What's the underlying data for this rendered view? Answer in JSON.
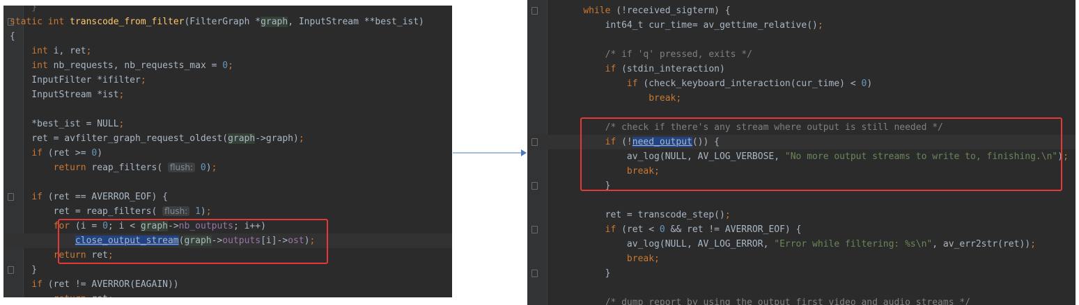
{
  "left": {
    "lines": [
      [
        {
          "t": "    }",
          "c": "fade"
        }
      ],
      [
        {
          "t": "static",
          "c": "kw"
        },
        {
          "t": " "
        },
        {
          "t": "int",
          "c": "kw"
        },
        {
          "t": " "
        },
        {
          "t": "transcode_from_filter",
          "c": "fn"
        },
        {
          "t": "(FilterGraph *"
        },
        {
          "t": "graph",
          "c": "param"
        },
        {
          "t": ", InputStream **best_ist)"
        }
      ],
      [
        {
          "t": "{"
        }
      ],
      [
        {
          "t": "    "
        },
        {
          "t": "int",
          "c": "kw"
        },
        {
          "t": " i, ret"
        },
        {
          "t": ";",
          "c": "kw"
        }
      ],
      [
        {
          "t": "    "
        },
        {
          "t": "int",
          "c": "kw"
        },
        {
          "t": " nb_requests, nb_requests_max = "
        },
        {
          "t": "0",
          "c": "num"
        },
        {
          "t": ";",
          "c": "kw"
        }
      ],
      [
        {
          "t": "    InputFilter *ifilter"
        },
        {
          "t": ";",
          "c": "kw"
        }
      ],
      [
        {
          "t": "    InputStream *ist"
        },
        {
          "t": ";",
          "c": "kw"
        }
      ],
      [
        {
          "t": ""
        }
      ],
      [
        {
          "t": "    *best_ist = NULL"
        },
        {
          "t": ";",
          "c": "kw"
        }
      ],
      [
        {
          "t": "    ret = avfilter_graph_request_oldest("
        },
        {
          "t": "graph",
          "c": "param"
        },
        {
          "t": "->graph)"
        },
        {
          "t": ";",
          "c": "kw"
        }
      ],
      [
        {
          "t": "    "
        },
        {
          "t": "if",
          "c": "kw"
        },
        {
          "t": " (ret >= "
        },
        {
          "t": "0",
          "c": "num"
        },
        {
          "t": ")"
        }
      ],
      [
        {
          "t": "        "
        },
        {
          "t": "return",
          "c": "kw"
        },
        {
          "t": " reap_filters( "
        },
        {
          "t": "flush:",
          "c": "hint"
        },
        {
          "t": " "
        },
        {
          "t": "0",
          "c": "num"
        },
        {
          "t": ")"
        },
        {
          "t": ";",
          "c": "kw"
        }
      ],
      [
        {
          "t": ""
        }
      ],
      [
        {
          "t": "    "
        },
        {
          "t": "if",
          "c": "kw"
        },
        {
          "t": " (ret == AVERROR_EOF) {"
        }
      ],
      [
        {
          "t": "        ret = reap_filters( "
        },
        {
          "t": "flush:",
          "c": "hint"
        },
        {
          "t": " "
        },
        {
          "t": "1",
          "c": "num"
        },
        {
          "t": ")"
        },
        {
          "t": ";",
          "c": "kw"
        }
      ],
      [
        {
          "t": "        "
        },
        {
          "t": "for",
          "c": "kw"
        },
        {
          "t": " (i = "
        },
        {
          "t": "0",
          "c": "num"
        },
        {
          "t": "; i < "
        },
        {
          "t": "graph",
          "c": "param"
        },
        {
          "t": "->"
        },
        {
          "t": "nb_outputs",
          "c": "fld"
        },
        {
          "t": "; i++)"
        }
      ],
      [
        {
          "t": "            "
        },
        {
          "t": "close_output_stream",
          "c": "sel"
        },
        {
          "t": "("
        },
        {
          "t": "graph",
          "c": "param"
        },
        {
          "t": "->"
        },
        {
          "t": "outputs",
          "c": "fld"
        },
        {
          "t": "[i]->"
        },
        {
          "t": "ost",
          "c": "fld"
        },
        {
          "t": ")"
        },
        {
          "t": ";",
          "c": "kw"
        }
      ],
      [
        {
          "t": "        "
        },
        {
          "t": "return",
          "c": "kw"
        },
        {
          "t": " ret"
        },
        {
          "t": ";",
          "c": "kw"
        }
      ],
      [
        {
          "t": "    }"
        }
      ],
      [
        {
          "t": "    "
        },
        {
          "t": "if",
          "c": "kw"
        },
        {
          "t": " (ret != AVERROR(EAGAIN))"
        }
      ],
      [
        {
          "t": "        "
        },
        {
          "t": "return",
          "c": "kw"
        },
        {
          "t": " ret"
        },
        {
          "t": ";",
          "c": "kw"
        }
      ]
    ]
  },
  "right": {
    "lines": [
      [
        {
          "t": "    "
        },
        {
          "t": "while",
          "c": "kw"
        },
        {
          "t": " (!received_sigterm) {"
        }
      ],
      [
        {
          "t": "        int64_t cur_time= av_gettime_relative()"
        },
        {
          "t": ";",
          "c": "kw"
        }
      ],
      [
        {
          "t": ""
        }
      ],
      [
        {
          "t": "        "
        },
        {
          "t": "/* if 'q' pressed, exits */",
          "c": "cm"
        }
      ],
      [
        {
          "t": "        "
        },
        {
          "t": "if",
          "c": "kw"
        },
        {
          "t": " (stdin_interaction)"
        }
      ],
      [
        {
          "t": "            "
        },
        {
          "t": "if",
          "c": "kw"
        },
        {
          "t": " (check_keyboard_interaction(cur_time) < "
        },
        {
          "t": "0",
          "c": "num"
        },
        {
          "t": ")"
        }
      ],
      [
        {
          "t": "                "
        },
        {
          "t": "break;",
          "c": "kw"
        }
      ],
      [
        {
          "t": ""
        }
      ],
      [
        {
          "t": "        "
        },
        {
          "t": "/* check if there's any stream where output is still needed */",
          "c": "cm"
        }
      ],
      [
        {
          "t": "        "
        },
        {
          "t": "if",
          "c": "kw"
        },
        {
          "t": " (!"
        },
        {
          "t": "need_output",
          "c": "sel"
        },
        {
          "t": "()) {"
        }
      ],
      [
        {
          "t": "            av_log(NULL, AV_LOG_VERBOSE, "
        },
        {
          "t": "\"No more output streams to write to, finishing.\\n\"",
          "c": "str"
        },
        {
          "t": ")"
        },
        {
          "t": ";",
          "c": "kw"
        }
      ],
      [
        {
          "t": "            "
        },
        {
          "t": "break;",
          "c": "kw"
        }
      ],
      [
        {
          "t": "        }"
        }
      ],
      [
        {
          "t": ""
        }
      ],
      [
        {
          "t": "        ret = transcode_step()"
        },
        {
          "t": ";",
          "c": "kw"
        }
      ],
      [
        {
          "t": "        "
        },
        {
          "t": "if",
          "c": "kw"
        },
        {
          "t": " (ret < "
        },
        {
          "t": "0",
          "c": "num"
        },
        {
          "t": " && ret != AVERROR_EOF) {"
        }
      ],
      [
        {
          "t": "            av_log(NULL, AV_LOG_ERROR, "
        },
        {
          "t": "\"Error while filtering: %s\\n\"",
          "c": "str"
        },
        {
          "t": ", av_err2str(ret))"
        },
        {
          "t": ";",
          "c": "kw"
        }
      ],
      [
        {
          "t": "            "
        },
        {
          "t": "break;",
          "c": "kw"
        }
      ],
      [
        {
          "t": "        }"
        }
      ],
      [
        {
          "t": ""
        }
      ],
      [
        {
          "t": "        "
        },
        {
          "t": "/* dump report by using the output first video and audio streams */",
          "c": "cm"
        }
      ]
    ]
  },
  "colors": {
    "editor_bg": "#2b2b2b",
    "highlight_box": "#e53935",
    "arrow": "#4a78c2",
    "keyword": "#cc7832",
    "function": "#ffc66d",
    "number": "#6897bb",
    "string": "#6a8759",
    "comment": "#808080"
  }
}
